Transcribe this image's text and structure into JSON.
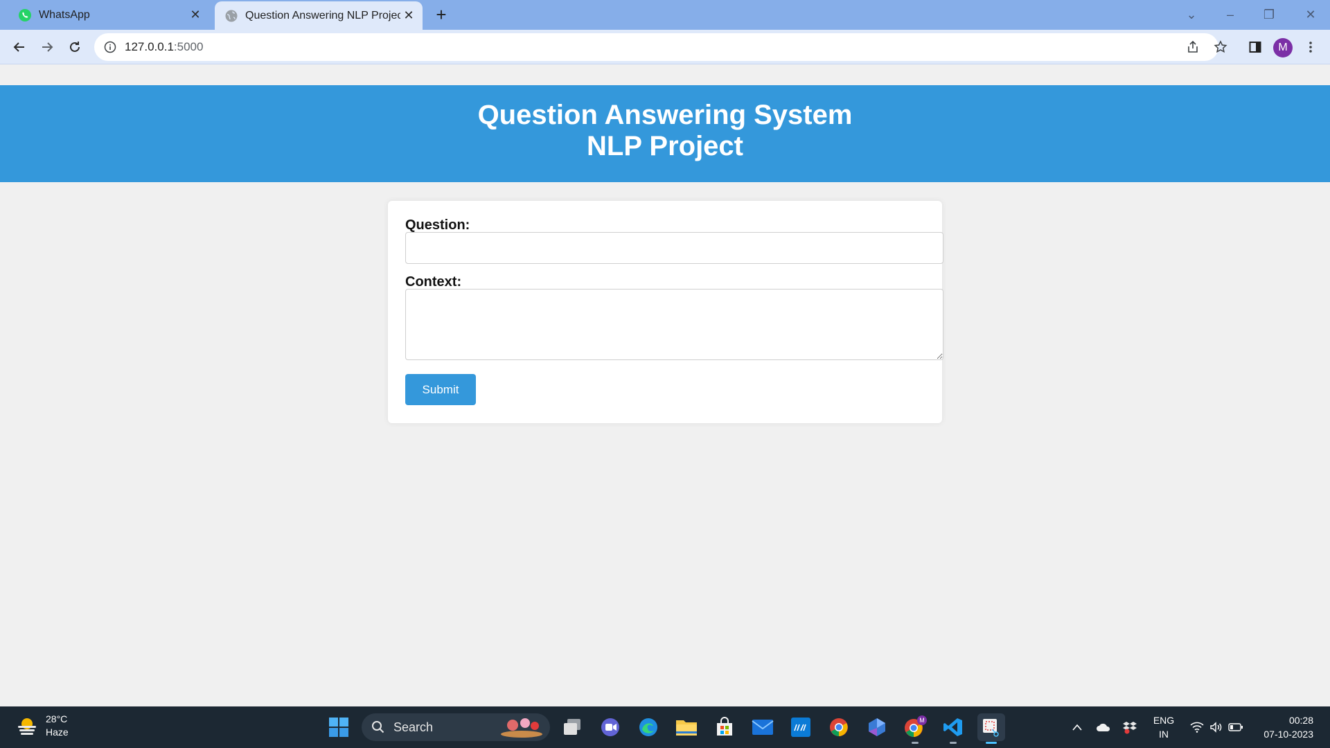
{
  "browser": {
    "tabs": [
      {
        "title": "WhatsApp",
        "active": false
      },
      {
        "title": "Question Answering NLP Project",
        "active": true
      }
    ],
    "url_host": "127.0.0.1",
    "url_port": ":5000",
    "profile_initial": "M"
  },
  "page": {
    "header_line1": "Question Answering System",
    "header_line2": "NLP Project",
    "question_label": "Question:",
    "question_value": "",
    "context_label": "Context:",
    "context_value": "",
    "submit_label": "Submit",
    "accent_color": "#3498db"
  },
  "taskbar": {
    "weather_temp": "28°C",
    "weather_desc": "Haze",
    "search_label": "Search",
    "lang_line1": "ENG",
    "lang_line2": "IN",
    "time": "00:28",
    "date": "07-10-2023",
    "apps": [
      "start-icon",
      "search",
      "task-view-icon",
      "teams-icon",
      "edge-icon",
      "file-explorer-icon",
      "store-icon",
      "mail-icon",
      "myhp-icon",
      "chrome-icon",
      "copilot-icon",
      "chrome-profile-icon",
      "vscode-icon",
      "snipping-tool-icon"
    ]
  }
}
